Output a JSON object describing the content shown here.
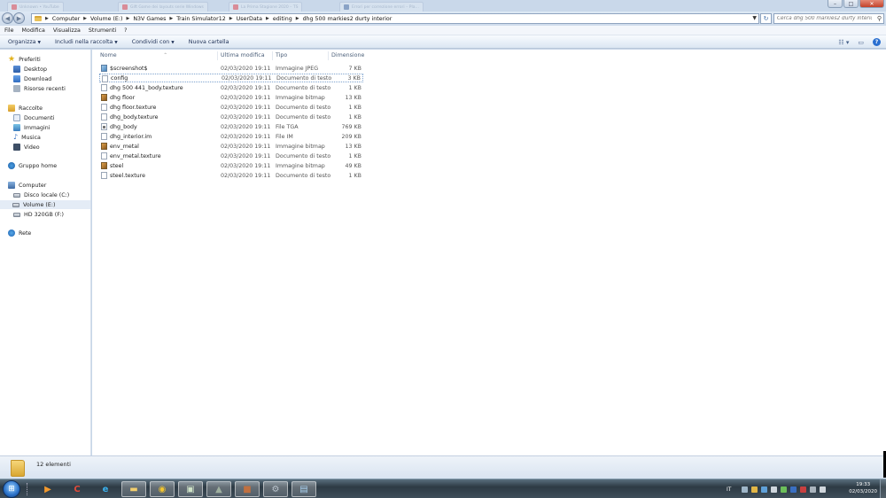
{
  "background_tabs": [
    {
      "label": "Unknown • YouTube",
      "color": "pink"
    },
    {
      "label": "Gift Game dei layouts serie Windows",
      "color": "pink"
    },
    {
      "label": "La Prima Stagione 2020 – TS",
      "color": "pink"
    },
    {
      "label": "Errori per correzione errori – Pla…",
      "color": "blue"
    }
  ],
  "address": {
    "breadcrumb": [
      "Computer",
      "Volume (E:)",
      "N3V Games",
      "Train Simulator12",
      "UserData",
      "editing",
      "dhg 500 markies2 durty interior"
    ],
    "search_placeholder": "Cerca dhg 500 markies2 durty interior"
  },
  "menu": [
    "File",
    "Modifica",
    "Visualizza",
    "Strumenti",
    "?"
  ],
  "commands": {
    "organize": "Organizza",
    "include": "Includi nella raccolta",
    "share": "Condividi con",
    "new_folder": "Nuova cartella"
  },
  "nav": {
    "favorites": "Preferiti",
    "desktop": "Desktop",
    "download": "Download",
    "recent": "Risorse recenti",
    "libraries": "Raccolte",
    "documents": "Documenti",
    "images": "Immagini",
    "music": "Musica",
    "video": "Video",
    "homegroup": "Gruppo home",
    "computer": "Computer",
    "drive_c": "Disco locale (C:)",
    "drive_e": "Volume (E:)",
    "drive_f": "HD 320GB (F:)",
    "network": "Rete"
  },
  "columns": {
    "name": "Nome",
    "modified": "Ultima modifica",
    "type": "Tipo",
    "size": "Dimensione"
  },
  "files": [
    {
      "name": "$screenshot$",
      "date": "02/03/2020 19:11",
      "type": "Immagine JPEG",
      "size": "7 KB",
      "icon": "jpg"
    },
    {
      "name": "config",
      "date": "02/03/2020 19:11",
      "type": "Documento di testo",
      "size": "3 KB",
      "icon": "txt"
    },
    {
      "name": "dhg 500 441_body.texture",
      "date": "02/03/2020 19:11",
      "type": "Documento di testo",
      "size": "1 KB",
      "icon": "txt"
    },
    {
      "name": "dhg floor",
      "date": "02/03/2020 19:11",
      "type": "Immagine bitmap",
      "size": "13 KB",
      "icon": "bmp"
    },
    {
      "name": "dhg floor.texture",
      "date": "02/03/2020 19:11",
      "type": "Documento di testo",
      "size": "1 KB",
      "icon": "txt"
    },
    {
      "name": "dhg_body.texture",
      "date": "02/03/2020 19:11",
      "type": "Documento di testo",
      "size": "1 KB",
      "icon": "txt"
    },
    {
      "name": "dhg_body",
      "date": "02/03/2020 19:11",
      "type": "File TGA",
      "size": "769 KB",
      "icon": "tga"
    },
    {
      "name": "dhg_interior.im",
      "date": "02/03/2020 19:11",
      "type": "File IM",
      "size": "209 KB",
      "icon": "txt"
    },
    {
      "name": "env_metal",
      "date": "02/03/2020 19:11",
      "type": "Immagine bitmap",
      "size": "13 KB",
      "icon": "bmp"
    },
    {
      "name": "env_metal.texture",
      "date": "02/03/2020 19:11",
      "type": "Documento di testo",
      "size": "1 KB",
      "icon": "txt"
    },
    {
      "name": "steel",
      "date": "02/03/2020 19:11",
      "type": "Immagine bitmap",
      "size": "49 KB",
      "icon": "bmp"
    },
    {
      "name": "steel.texture",
      "date": "02/03/2020 19:11",
      "type": "Documento di testo",
      "size": "1 KB",
      "icon": "txt"
    }
  ],
  "status": {
    "count": "12 elementi"
  },
  "taskbar": {
    "language": "IT",
    "time": "19:33",
    "date": "02/03/2020"
  }
}
